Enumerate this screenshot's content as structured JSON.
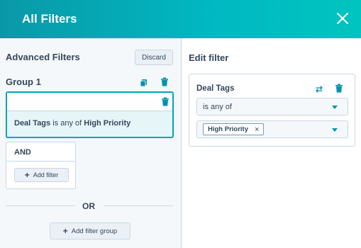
{
  "header": {
    "title": "All Filters"
  },
  "left": {
    "title": "Advanced Filters",
    "discard_label": "Discard",
    "group_title": "Group 1",
    "filter": {
      "property": "Deal Tags",
      "operator": "is any of",
      "value": "High Priority"
    },
    "and_label": "AND",
    "add_filter_label": "Add filter",
    "or_label": "OR",
    "add_group_label": "Add filter group"
  },
  "right": {
    "title": "Edit filter",
    "property": "Deal Tags",
    "operator": "is any of",
    "chip_label": "High Priority"
  },
  "colors": {
    "accent": "#00a4bd",
    "link": "#0091ae",
    "text": "#33475b"
  }
}
